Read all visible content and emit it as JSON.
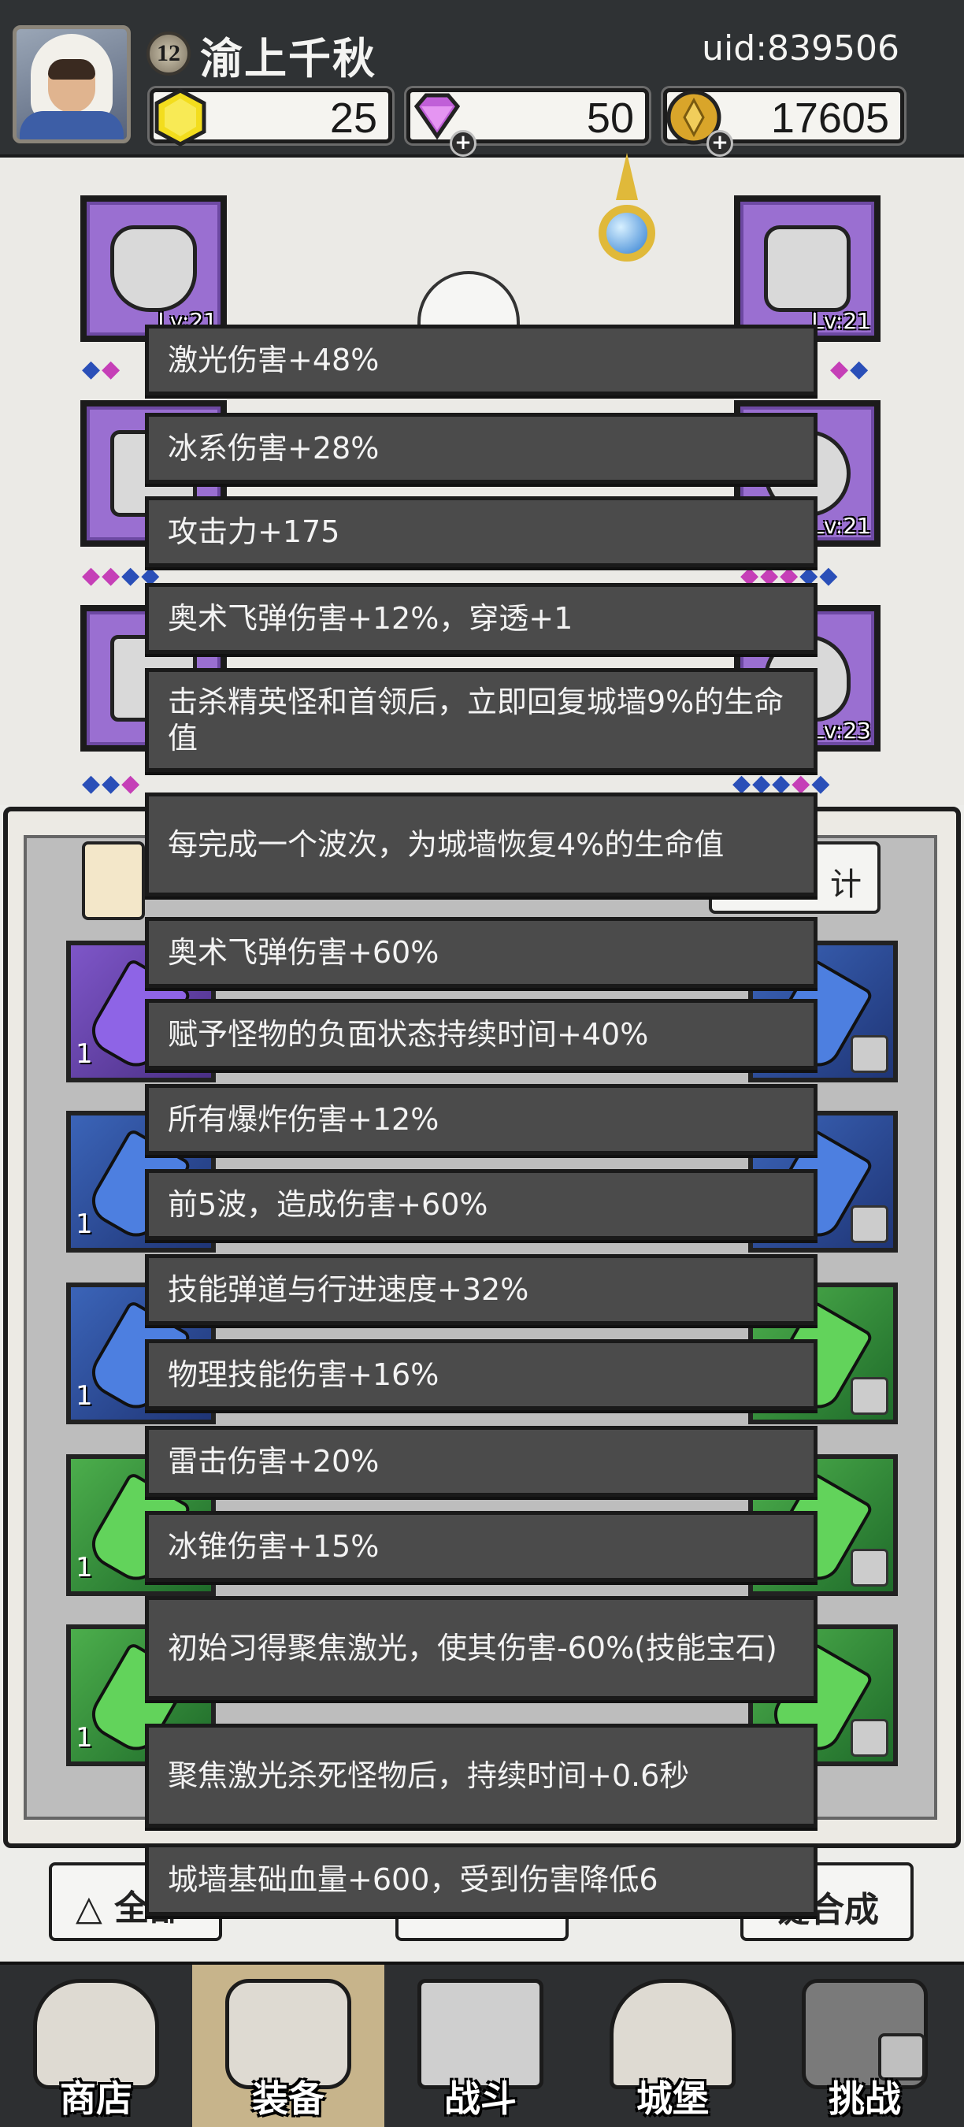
{
  "header": {
    "player_name": "渝上千秋",
    "level": "12",
    "uid": "uid:839506",
    "currencies": [
      {
        "name": "gold-gem",
        "value": "25",
        "color": "#f3dd1d"
      },
      {
        "name": "diamond",
        "value": "50",
        "color": "#c05fd8"
      },
      {
        "name": "coin",
        "value": "17605",
        "color": "#d9a52a"
      }
    ]
  },
  "equipment": {
    "slots": [
      {
        "id": "helmet",
        "level": "Lv:21"
      },
      {
        "id": "weapon-arm",
        "level": "Lv:21"
      },
      {
        "id": "armor",
        "level": ""
      },
      {
        "id": "ring",
        "level": "Lv:21"
      },
      {
        "id": "boots",
        "level": ""
      },
      {
        "id": "necklace",
        "level": "Lv:23"
      }
    ]
  },
  "inventory": {
    "stats_button": "计",
    "slot_count_label": "1",
    "buttons": {
      "all": "全部",
      "merge": "键合成"
    }
  },
  "tooltip": {
    "rows": [
      "激光伤害+48%",
      "冰系伤害+28%",
      "攻击力+175",
      "奥术飞弹伤害+12%，穿透+1",
      "击杀精英怪和首领后，立即回复城墙9%的生命值",
      "每完成一个波次，为城墙恢复4%的生命值",
      "奥术飞弹伤害+60%",
      "赋予怪物的负面状态持续时间+40%",
      "所有爆炸伤害+12%",
      "前5波，造成伤害+60%",
      "技能弹道与行进速度+32%",
      "物理技能伤害+16%",
      "雷击伤害+20%",
      "冰锥伤害+15%",
      "初始习得聚焦激光，使其伤害-60%(技能宝石)",
      "聚焦激光杀死怪物后，持续时间+0.6秒",
      "城墙基础血量+600，受到伤害降低6"
    ]
  },
  "nav": {
    "items": [
      {
        "id": "shop",
        "label": "商店"
      },
      {
        "id": "equipment",
        "label": "装备"
      },
      {
        "id": "battle",
        "label": "战斗"
      },
      {
        "id": "castle",
        "label": "城堡"
      },
      {
        "id": "challenge",
        "label": "挑战"
      }
    ],
    "active": "equipment"
  }
}
